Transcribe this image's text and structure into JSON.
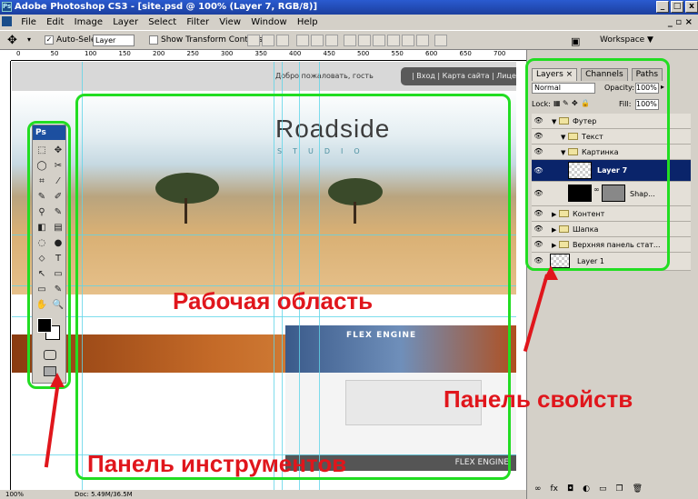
{
  "window": {
    "title": "Adobe Photoshop CS3 - [site.psd @ 100% (Layer 7, RGB/8)]",
    "app_icon": "Ps",
    "minimize": "_",
    "maximize": "□",
    "close": "x",
    "doc_controls": "_ ▫ ×"
  },
  "menu": [
    "File",
    "Edit",
    "Image",
    "Layer",
    "Select",
    "Filter",
    "View",
    "Window",
    "Help"
  ],
  "options": {
    "auto_select_label": "Auto-Select:",
    "auto_select_value": "Layer",
    "transform_controls_label": "Show Transform Controls",
    "workspace_label": "Workspace ▼"
  },
  "ruler_ticks": [
    "0",
    "50",
    "100",
    "150",
    "200",
    "250",
    "300",
    "350",
    "400",
    "450",
    "500",
    "550",
    "600",
    "650",
    "700",
    "750"
  ],
  "canvas": {
    "welcome": "Добро пожаловать, гость",
    "login_links": "| Вход | Карта сайта | Лицензия",
    "logo": "Roadside",
    "logo_sub": "STUDIO",
    "flex_label": "FLEX ENGINE",
    "footer_label": "FLEX ENGINE"
  },
  "tools": {
    "header": "Ps",
    "icons": [
      "⬚",
      "✥",
      "◯",
      "✂",
      "⌗",
      "⁄",
      "✎",
      "✐",
      "⚲",
      "✎",
      "◧",
      "▤",
      "◌",
      "●",
      "⬦",
      "T",
      "↖",
      "▭",
      "▭",
      "✎",
      "✋",
      "🔍"
    ]
  },
  "layers_panel": {
    "tabs": [
      "Layers ×",
      "Channels",
      "Paths"
    ],
    "blend_mode": "Normal",
    "opacity_label": "Opacity:",
    "opacity_value": "100%",
    "lock_label": "Lock:",
    "fill_label": "Fill:",
    "fill_value": "100%",
    "layers": [
      {
        "name": "Футер",
        "expanded": true,
        "depth": 0
      },
      {
        "name": "Текст",
        "expanded": true,
        "depth": 1
      },
      {
        "name": "Картинка",
        "expanded": true,
        "depth": 1
      },
      {
        "name": "Layer 7",
        "selected": true,
        "depth": 2
      },
      {
        "name": "Shap...",
        "depth": 2
      },
      {
        "name": "Контент",
        "expanded": false,
        "depth": 0
      },
      {
        "name": "Шапка",
        "expanded": false,
        "depth": 0
      },
      {
        "name": "Верхняя панель стат...",
        "expanded": false,
        "depth": 0
      },
      {
        "name": "Layer 1",
        "depth": 0
      }
    ],
    "bottom_icons": [
      "link-icon",
      "fx-icon",
      "mask-icon",
      "adjustment-icon",
      "folder-icon",
      "new-layer-icon",
      "trash-icon"
    ]
  },
  "status": {
    "zoom": "100%",
    "doc": "Doc: 5.49M/36.5M"
  },
  "annotations": {
    "workspace": "Рабочая область",
    "properties": "Панель свойств",
    "tools": "Панель инструментов"
  },
  "colors": {
    "annotation_red": "#e0161c",
    "annotation_green": "#22dd22",
    "titlebar_blue": "#1c3f9e",
    "selected_layer": "#0a246a"
  }
}
